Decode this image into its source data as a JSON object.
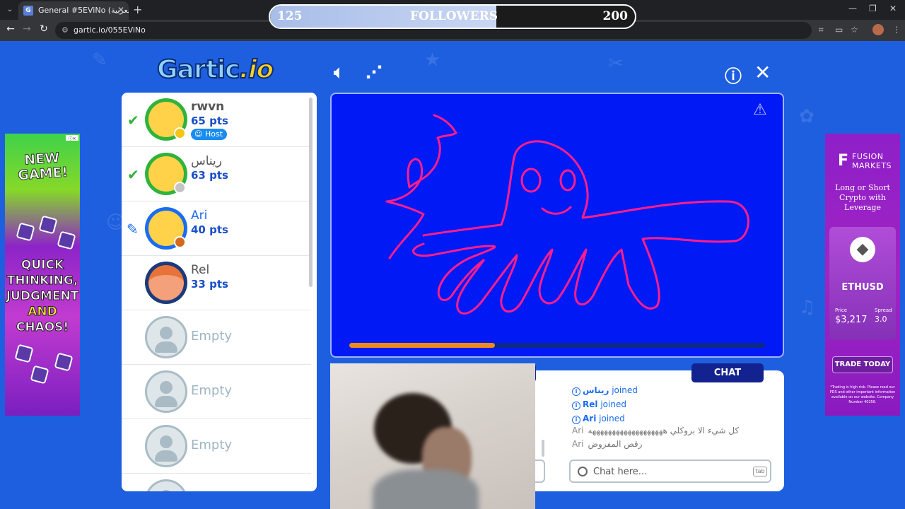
{
  "browser": {
    "tab_title": "General #5EViNo (العربية) - Gart",
    "tab_favicon": "G",
    "url": "gartic.io/055EViNo"
  },
  "followers_bar": {
    "current": "125",
    "label": "FOLLOWERS",
    "goal": "200",
    "progress": 0.62
  },
  "logo": {
    "main": "Gartic",
    "suffix": ".io"
  },
  "icons": {
    "sound": "speaker-icon",
    "share": "share-icon",
    "info": "info-icon",
    "close": "close-icon",
    "report": "warning-icon"
  },
  "players": [
    {
      "name": "rwvn",
      "points": "65 pts",
      "status": "guessed",
      "dot_color": "#f5c518",
      "host_label": "Host",
      "avatar": "smiley"
    },
    {
      "name": "ريناس",
      "points": "63 pts",
      "status": "guessed",
      "dot_color": "#c4c4c4",
      "host_label": "",
      "avatar": "smiley"
    },
    {
      "name": "Ari",
      "points": "40 pts",
      "status": "drawing",
      "dot_color": "#d2691e",
      "host_label": "",
      "avatar": "smiley"
    },
    {
      "name": "Rel",
      "points": "33 pts",
      "status": "",
      "dot_color": "",
      "host_label": "",
      "avatar": "girl"
    }
  ],
  "empty_slots": [
    "Empty",
    "Empty",
    "Empty"
  ],
  "canvas": {
    "background": "#0019f5",
    "stroke_color": "#ff1e8c",
    "timer_progress": 0.35
  },
  "chat": {
    "tab_label": "CHAT",
    "join_messages": [
      {
        "name": "ريناس",
        "text": "joined"
      },
      {
        "name": "Rel",
        "text": "joined"
      },
      {
        "name": "Ari",
        "text": "joined"
      }
    ],
    "messages": [
      {
        "name": "Ari",
        "text": "كل شيء الا بروكلي هههههههههههههههههههه"
      },
      {
        "name": "Ari",
        "text": "رقص المفروض"
      }
    ],
    "placeholder": "Chat here...",
    "tab_key": "tab"
  },
  "ads": {
    "left": {
      "title": "NEW GAME!",
      "line1": "QUICK",
      "line2": "THINKING,",
      "line3": "JUDGMENT",
      "line4": "AND",
      "line5": "CHAOS!"
    },
    "right": {
      "brand": "FUSION MARKETS",
      "headline": "Long or Short Crypto with Leverage",
      "symbol": "ETHUSD",
      "price_label": "Price",
      "price": "$3,217",
      "spread_label": "Spread",
      "spread": "3.0",
      "cta": "TRADE TODAY",
      "fine_print": "*Trading is high risk. Please read our PDS and other important information available on our website. Company Number 40256."
    }
  }
}
